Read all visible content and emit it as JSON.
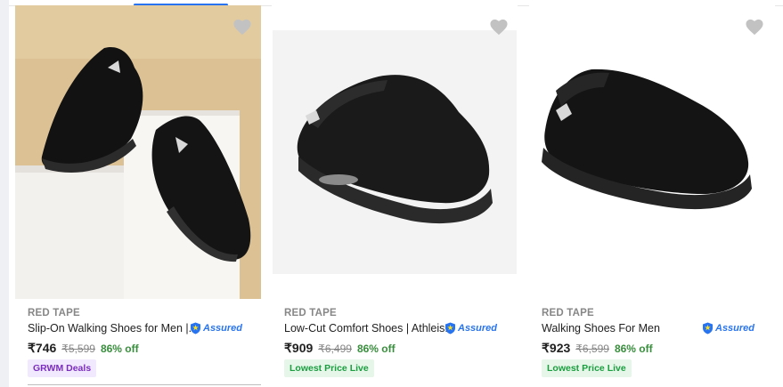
{
  "products": [
    {
      "brand": "RED TAPE",
      "title": "Slip-On Walking Shoes for Men |...",
      "assured": "Assured",
      "price": "₹746",
      "mrp": "₹5,599",
      "discount": "86% off",
      "badge": "GRWM Deals",
      "wishlist_icon": "heart-icon"
    },
    {
      "brand": "RED TAPE",
      "title": "Low-Cut Comfort Shoes | Athleis...",
      "assured": "Assured",
      "price": "₹909",
      "mrp": "₹6,499",
      "discount": "86% off",
      "badge": "Lowest Price Live",
      "wishlist_icon": "heart-icon"
    },
    {
      "brand": "RED TAPE",
      "title": "Walking Shoes For Men",
      "assured": "Assured",
      "price": "₹923",
      "mrp": "₹6,599",
      "discount": "86% off",
      "badge": "Lowest Price Live",
      "wishlist_icon": "heart-icon"
    }
  ],
  "colors": {
    "accent": "#2874f0",
    "discount": "#388e3c",
    "deals_badge_text": "#7b2cbf",
    "lowest_badge_text": "#1a9e3f",
    "heart": "#c2c2c2"
  }
}
